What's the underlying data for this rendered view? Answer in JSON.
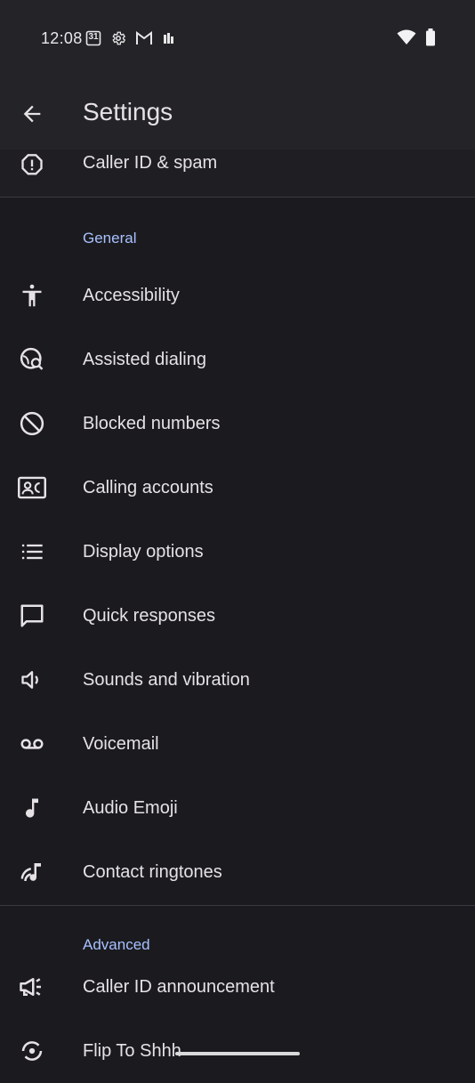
{
  "status_bar": {
    "time": "12:08",
    "calendar_day": "31",
    "left_icons": [
      "calendar-icon",
      "settings-gear-icon",
      "gmail-icon",
      "assistant-icon"
    ],
    "right_icons": [
      "wifi-icon",
      "battery-icon"
    ]
  },
  "app_bar": {
    "title": "Settings",
    "back_icon": "arrow-back-icon"
  },
  "top_item": {
    "label": "Caller ID & spam",
    "icon": "spam-alert-icon"
  },
  "general": {
    "header": "General",
    "items": [
      {
        "label": "Accessibility",
        "icon": "accessibility-icon"
      },
      {
        "label": "Assisted dialing",
        "icon": "globe-search-icon"
      },
      {
        "label": "Blocked numbers",
        "icon": "block-icon"
      },
      {
        "label": "Calling accounts",
        "icon": "contact-card-icon"
      },
      {
        "label": "Display options",
        "icon": "list-icon"
      },
      {
        "label": "Quick responses",
        "icon": "chat-bubble-icon"
      },
      {
        "label": "Sounds and vibration",
        "icon": "volume-icon"
      },
      {
        "label": "Voicemail",
        "icon": "voicemail-icon"
      },
      {
        "label": "Audio Emoji",
        "icon": "music-note-icon"
      },
      {
        "label": "Contact ringtones",
        "icon": "ringtone-icon"
      }
    ]
  },
  "advanced": {
    "header": "Advanced",
    "items": [
      {
        "label": "Caller ID announcement",
        "icon": "announcement-icon"
      },
      {
        "label": "Flip To Shhh",
        "icon": "flip-icon"
      }
    ]
  },
  "colors": {
    "background": "#1b1b1f",
    "bar": "#242428",
    "accent": "#a8c0ff",
    "text": "#e6e1e5"
  }
}
